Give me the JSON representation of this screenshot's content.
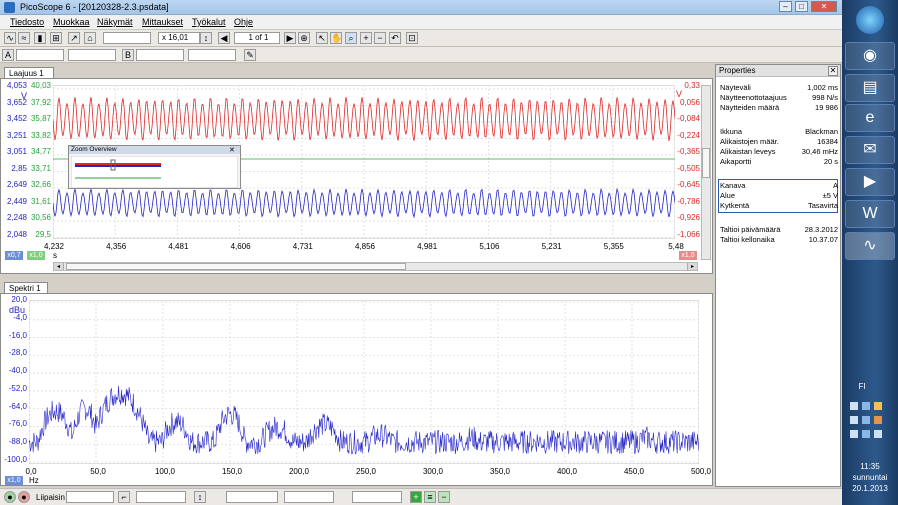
{
  "window": {
    "title": "PicoScope 6 - [20120328-2.3.psdata]"
  },
  "menu": [
    "Tiedosto",
    "Muokkaa",
    "Näkymät",
    "Mittaukset",
    "Työkalut",
    "Ohje"
  ],
  "toolbar": {
    "zoom_value": "x 16,01",
    "page_indicator": "1 of 1"
  },
  "scope": {
    "tab": "Laajuus 1",
    "left_axis_blue": [
      "4,053",
      "3,652",
      "3,452",
      "3,251",
      "3,051",
      "2,85",
      "2,649",
      "2,449",
      "2,248",
      "2,048"
    ],
    "left_axis_unit": "V",
    "left_axis_green": [
      "40,03",
      "37,92",
      "35,87",
      "33,82",
      "34,77",
      "33,71",
      "32,66",
      "31,61",
      "30,56",
      "29,5"
    ],
    "right_axis_red": [
      "0,33",
      "0,056",
      "-0,084",
      "-0,224",
      "-0,365",
      "-0,505",
      "-0,645",
      "-0,786",
      "-0,926",
      "-1,066"
    ],
    "right_axis_unit": "V",
    "x_ticks": [
      "4,232",
      "4,356",
      "4,481",
      "4,606",
      "4,731",
      "4,856",
      "4,981",
      "5,106",
      "5,231",
      "5,355",
      "5,48"
    ],
    "x_unit": "s",
    "left_badge": "x0,7",
    "left_badge2": "x1,0",
    "right_badge": "x1,0",
    "zoom_overview_title": "Zoom Overview",
    "series_colors": {
      "red": "#e02828",
      "blue": "#2323c8",
      "green": "#26a63a"
    }
  },
  "spectrum": {
    "tab": "Spektri 1",
    "y_ticks": [
      "20,0",
      "-4,0",
      "-16,0",
      "-28,0",
      "-40,0",
      "-52,0",
      "-64,0",
      "-76,0",
      "-88,0",
      "-100,0"
    ],
    "y_unit": "dBu",
    "x_ticks": [
      "0,0",
      "50,0",
      "100,0",
      "150,0",
      "200,0",
      "250,0",
      "300,0",
      "350,0",
      "400,0",
      "450,0",
      "500,0"
    ],
    "x_unit": "Hz",
    "badge": "x1,0",
    "trace_color": "#2323c8"
  },
  "properties": {
    "title": "Properties",
    "g1": [
      {
        "k": "Näyteväli",
        "v": "1,002 ms"
      },
      {
        "k": "Näytteenottotaajuus",
        "v": "998 N/s"
      },
      {
        "k": "Näytteiden määrä",
        "v": "19 986"
      }
    ],
    "g2": [
      {
        "k": "Ikkuna",
        "v": "Blackman"
      },
      {
        "k": "Alikaistojen määr.",
        "v": "16384"
      },
      {
        "k": "Alikaistan leveys",
        "v": "30,46 mHz"
      },
      {
        "k": "Aikaportti",
        "v": "20 s"
      }
    ],
    "g3": [
      {
        "k": "Kanava",
        "v": "A"
      },
      {
        "k": "Alue",
        "v": "±5 V"
      },
      {
        "k": "Kytkentä",
        "v": "Tasavirta"
      }
    ],
    "g4": [
      {
        "k": "Taltioi päivämäärä",
        "v": "28.3.2012"
      },
      {
        "k": "Taltioi kellonaika",
        "v": "10.37.07"
      }
    ]
  },
  "status": {
    "trigger_label": "Liipaisin"
  },
  "taskbar": {
    "lang": "FI",
    "time": "11:35",
    "day": "sunnuntai",
    "date": "20.1.2013"
  }
}
